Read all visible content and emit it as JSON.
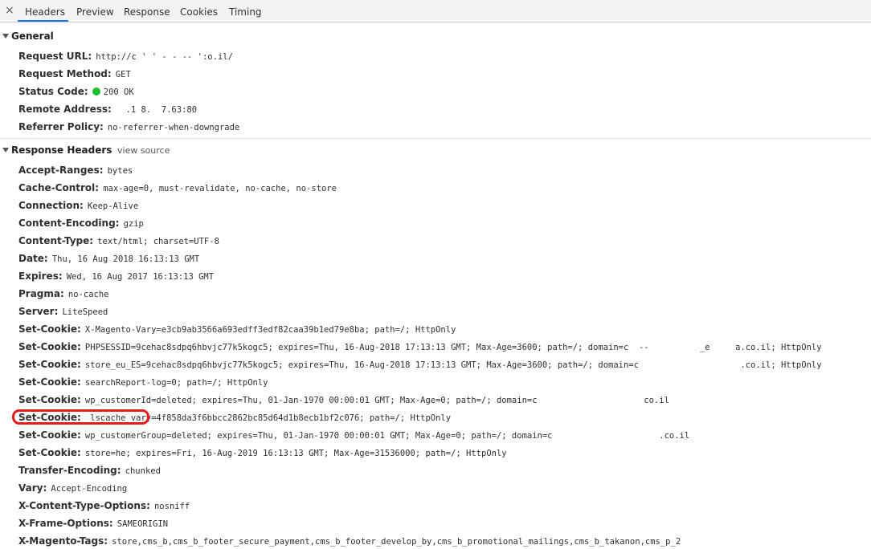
{
  "tabs": {
    "close_glyph": "×",
    "items": [
      "Headers",
      "Preview",
      "Response",
      "Cookies",
      "Timing"
    ]
  },
  "general": {
    "title": "General",
    "rows": [
      {
        "key": "Request URL:",
        "value": "http://c    '  '  -          -   -- ':o.il/"
      },
      {
        "key": "Request Method:",
        "value": "GET"
      },
      {
        "key": "Status Code:",
        "value": "200 OK"
      },
      {
        "key": "Remote Address:",
        "value": "  .1 8.  7.63:80"
      },
      {
        "key": "Referrer Policy:",
        "value": "no-referrer-when-downgrade"
      }
    ]
  },
  "response": {
    "title": "Response Headers",
    "view_source": "view source",
    "rows": [
      {
        "key": "Accept-Ranges:",
        "value": "bytes"
      },
      {
        "key": "Cache-Control:",
        "value": "max-age=0, must-revalidate, no-cache, no-store"
      },
      {
        "key": "Connection:",
        "value": "Keep-Alive"
      },
      {
        "key": "Content-Encoding:",
        "value": "gzip"
      },
      {
        "key": "Content-Type:",
        "value": "text/html; charset=UTF-8"
      },
      {
        "key": "Date:",
        "value": "Thu, 16 Aug 2018 16:13:13 GMT"
      },
      {
        "key": "Expires:",
        "value": "Wed, 16 Aug 2017 16:13:13 GMT"
      },
      {
        "key": "Pragma:",
        "value": "no-cache"
      },
      {
        "key": "Server:",
        "value": "LiteSpeed"
      },
      {
        "key": "Set-Cookie:",
        "value": "X-Magento-Vary=e3cb9ab3566a693edff3edf82caa39b1ed79e8ba; path=/; HttpOnly"
      },
      {
        "key": "Set-Cookie:",
        "value": "PHPSESSID=9cehac8sdpq6hbvjc77k5kogc5; expires=Thu, 16-Aug-2018 17:13:13 GMT; Max-Age=3600; path=/; domain=c  --          _e     a.co.il; HttpOnly"
      },
      {
        "key": "Set-Cookie:",
        "value": "store_eu_ES=9cehac8sdpq6hbvjc77k5kogc5; expires=Thu, 16-Aug-2018 17:13:13 GMT; Max-Age=3600; path=/; domain=c                    .co.il; HttpOnly"
      },
      {
        "key": "Set-Cookie:",
        "value": "searchReport-log=0; path=/; HttpOnly"
      },
      {
        "key": "Set-Cookie:",
        "value": "wp_customerId=deleted; expires=Thu, 01-Jan-1970 00:00:01 GMT; Max-Age=0; path=/; domain=c                     co.il"
      },
      {
        "key": "Set-Cookie:",
        "value": "_lscache_vary=4f858da3f6bbcc2862bc85d64d1b8ecb1bf2c076; path=/; HttpOnly"
      },
      {
        "key": "Set-Cookie:",
        "value": "wp_customerGroup=deleted; expires=Thu, 01-Jan-1970 00:00:01 GMT; Max-Age=0; path=/; domain=c                     .co.il"
      },
      {
        "key": "Set-Cookie:",
        "value": "store=he; expires=Fri, 16-Aug-2019 16:13:13 GMT; Max-Age=31536000; path=/; HttpOnly"
      },
      {
        "key": "Transfer-Encoding:",
        "value": "chunked"
      },
      {
        "key": "Vary:",
        "value": "Accept-Encoding"
      },
      {
        "key": "X-Content-Type-Options:",
        "value": "nosniff"
      },
      {
        "key": "X-Frame-Options:",
        "value": "SAMEORIGIN"
      },
      {
        "key": "X-Magento-Tags:",
        "value": "store,cms_b,cms_b_footer_secure_payment,cms_b_footer_develop_by,cms_b_promotional_mailings,cms_b_takanon,cms_p_2"
      }
    ]
  },
  "colors": {
    "accent": "#1a73e8",
    "status_ok": "#1dbe2a",
    "highlight": "#e21b1b"
  }
}
